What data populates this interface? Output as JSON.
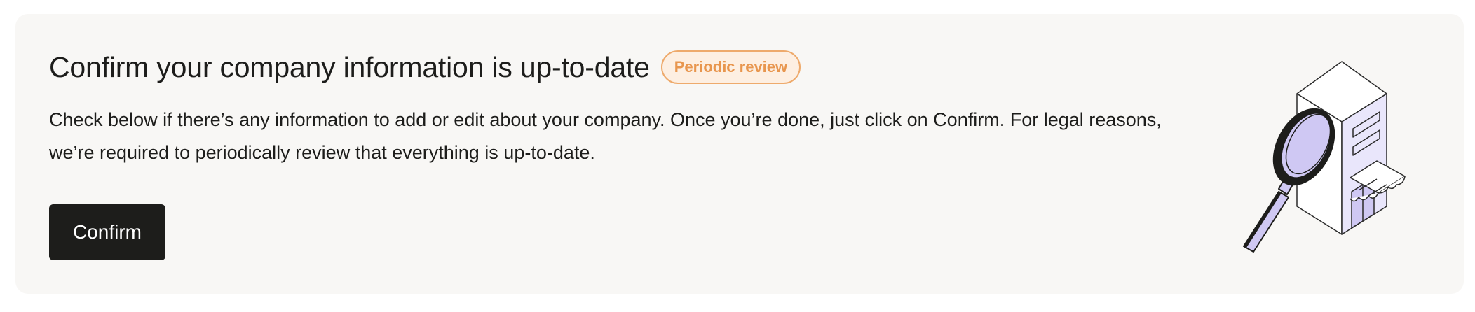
{
  "card": {
    "title": "Confirm your company information is up-to-date",
    "badge": "Periodic review",
    "description": "Check below if there’s any information to add or edit about your company. Once you’re done, just click on Confirm. For legal reasons, we’re required to periodically review that everything is up-to-date.",
    "confirm_label": "Confirm",
    "illustration": "magnifying-glass-building"
  },
  "colors": {
    "card_background": "#f8f7f5",
    "badge_text": "#e8964e",
    "badge_border": "#eeaa6c",
    "badge_fill": "#fdefe2",
    "button_background": "#1d1d1b",
    "illustration_accent": "#cfc8f3"
  }
}
